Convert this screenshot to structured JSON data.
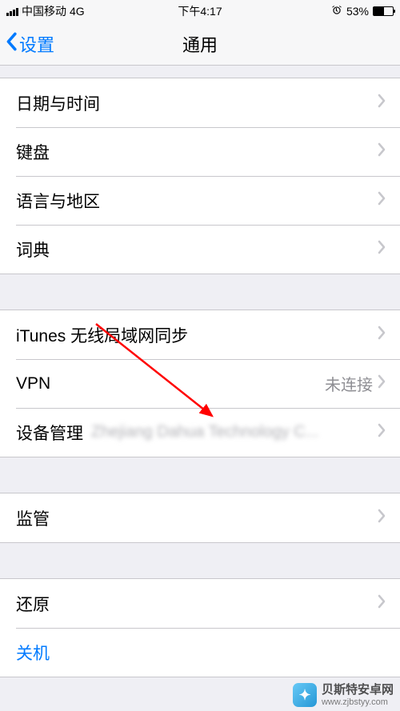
{
  "status": {
    "carrier": "中国移动",
    "network": "4G",
    "time": "下午4:17",
    "alarm_icon": "⏰",
    "battery_pct": "53%"
  },
  "nav": {
    "back_label": "设置",
    "title": "通用"
  },
  "groups": [
    {
      "rows": [
        {
          "label": "日期与时间",
          "value": "",
          "type": "nav"
        },
        {
          "label": "键盘",
          "value": "",
          "type": "nav"
        },
        {
          "label": "语言与地区",
          "value": "",
          "type": "nav"
        },
        {
          "label": "词典",
          "value": "",
          "type": "nav"
        }
      ]
    },
    {
      "rows": [
        {
          "label": "iTunes 无线局域网同步",
          "value": "",
          "type": "nav"
        },
        {
          "label": "VPN",
          "value": "未连接",
          "type": "nav"
        },
        {
          "label": "设备管理",
          "value": "Zhejiang Dahua Technology C...",
          "blurred": true,
          "type": "nav"
        }
      ]
    },
    {
      "rows": [
        {
          "label": "监管",
          "value": "",
          "type": "nav"
        }
      ]
    },
    {
      "rows": [
        {
          "label": "还原",
          "value": "",
          "type": "nav"
        },
        {
          "label": "关机",
          "value": "",
          "type": "action"
        }
      ]
    }
  ],
  "watermark": {
    "name": "贝斯特安卓网",
    "url": "www.zjbstyy.com"
  },
  "annotation": {
    "color": "#ff0000"
  }
}
